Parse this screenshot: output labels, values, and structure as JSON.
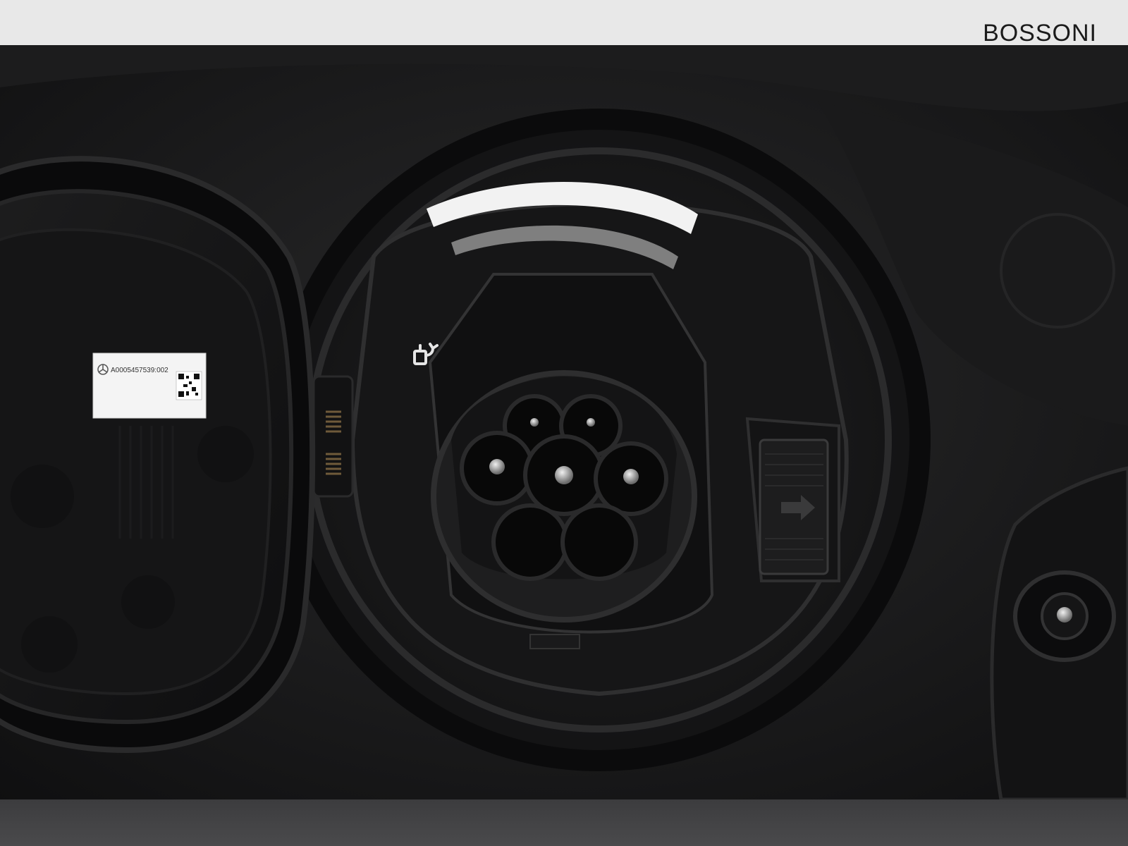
{
  "brand": {
    "logo_text": "BOSSONI"
  },
  "lid_label": {
    "part_number": "A0005457539:002"
  },
  "colors": {
    "background_band": "#e8e8e8",
    "bottom_band": "#3c3c3e",
    "body_black": "#141414",
    "socket_black": "#0c0c0c",
    "led_ring": "#f2f2f2"
  },
  "icons": {
    "charging_symbol": "plug-lock-icon",
    "latch_arrow": "arrow-right-icon",
    "label_logo": "mercedes-star-icon",
    "label_code": "qr-code-icon"
  }
}
